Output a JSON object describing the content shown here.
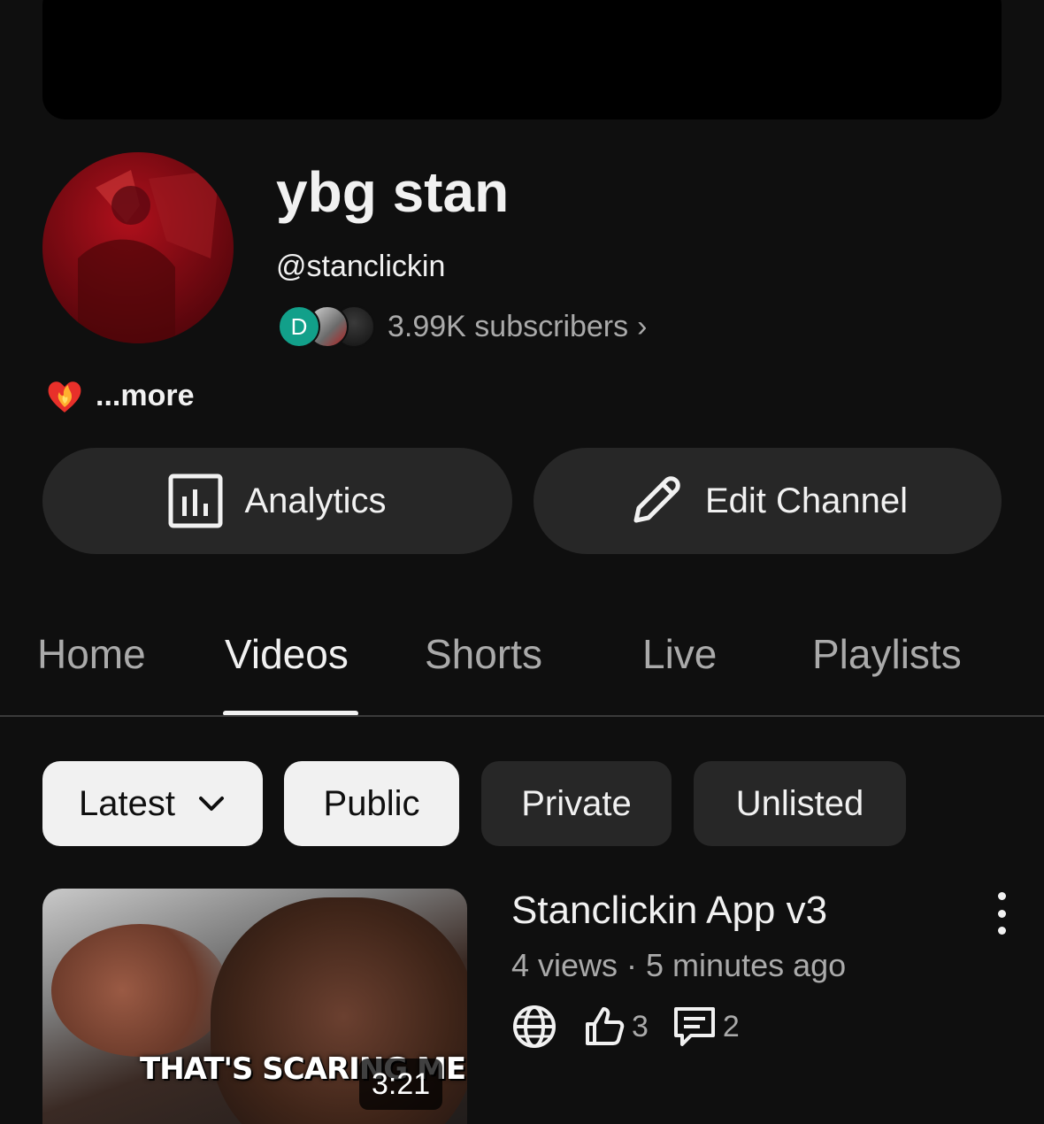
{
  "channel": {
    "name": "ybg stan",
    "handle": "@stanclickin",
    "subscriber_initial": "D",
    "subscribers": "3.99K subscribers",
    "subscribers_chevron": "›",
    "description_more": "...more"
  },
  "actions": {
    "analytics_label": "Analytics",
    "edit_label": "Edit Channel"
  },
  "tabs": [
    {
      "label": "Home"
    },
    {
      "label": "Videos",
      "active": true
    },
    {
      "label": "Shorts"
    },
    {
      "label": "Live"
    },
    {
      "label": "Playlists"
    }
  ],
  "filters": {
    "sort_label": "Latest",
    "chips": [
      "Public",
      "Private",
      "Unlisted"
    ]
  },
  "videos": [
    {
      "title": "Stanclickin App v3",
      "meta": "4 views · 5 minutes ago",
      "thumbnail_caption": "THAT'S SCARING ME",
      "duration": "3:21",
      "likes": "3",
      "comments": "2",
      "visibility_icon": "globe-icon"
    }
  ],
  "colors": {
    "background": "#0f0f0f",
    "button_bg": "#272727",
    "chip_selected_bg": "#f1f1f1",
    "secondary_text": "#aaaaaa"
  }
}
